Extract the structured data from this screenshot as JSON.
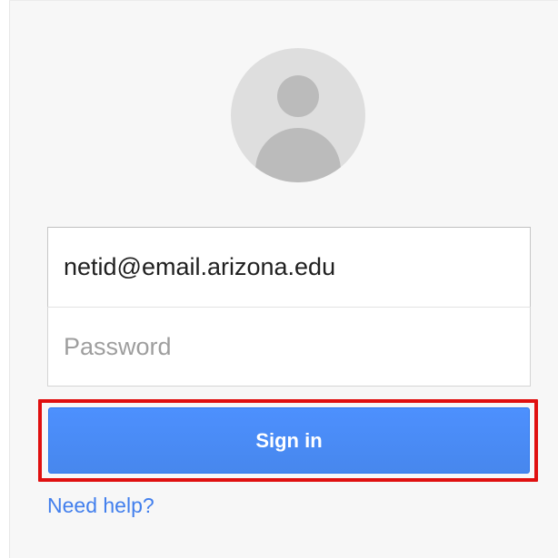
{
  "login": {
    "email_value": "netid@email.arizona.edu",
    "password_placeholder": "Password",
    "signin_label": "Sign in",
    "help_link": "Need help?"
  },
  "icons": {
    "avatar": "default-user-avatar-icon"
  },
  "colors": {
    "card_background": "#f7f7f7",
    "button_blue": "#4d90fe",
    "link_blue": "#427fed",
    "highlight_red": "#e01010",
    "avatar_gray": "#dedede"
  }
}
